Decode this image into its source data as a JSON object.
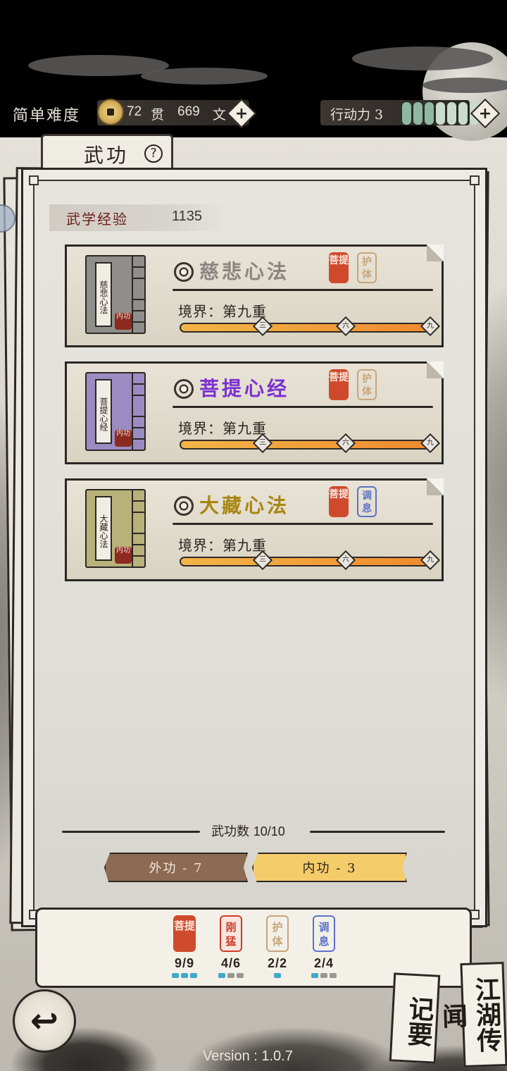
{
  "status": {
    "difficulty": "简单难度",
    "money_guan": "72",
    "money_guan_unit": "贯",
    "money_wen": "669",
    "money_wen_unit": "文",
    "action_label": "行动力 3",
    "action_pips_filled": 3,
    "action_pips_total": 7,
    "plus": "+"
  },
  "tab": {
    "title": "武功",
    "help": "?"
  },
  "exp": {
    "label": "武学经验",
    "value": "1135"
  },
  "skills": [
    {
      "name": "慈悲心法",
      "name_color": "#8a8781",
      "book_title": "慈悲心法",
      "book_color": "#8f8e8b",
      "book_seal": "内功",
      "tag1": "菩提",
      "tag2": "护体",
      "tag2_style": "tan",
      "realm": "境界：第九重",
      "marks": [
        "三",
        "六",
        "九"
      ],
      "progress": 1.0
    },
    {
      "name": "菩提心经",
      "name_color": "#7b2fd0",
      "book_title": "菩提心经",
      "book_color": "#9a8cc2",
      "book_seal": "内功",
      "tag1": "菩提",
      "tag2": "护体",
      "tag2_style": "tan",
      "realm": "境界：第九重",
      "marks": [
        "三",
        "六",
        "九"
      ],
      "progress": 1.0
    },
    {
      "name": "大藏心法",
      "name_color": "#a88612",
      "book_title": "大藏心法",
      "book_color": "#b8b27a",
      "book_seal": "内功",
      "tag1": "菩提",
      "tag2": "调息",
      "tag2_style": "blue",
      "realm": "境界：第九重",
      "marks": [
        "三",
        "六",
        "九"
      ],
      "progress": 1.0
    }
  ],
  "count": {
    "label": "武功数",
    "value": "10/10"
  },
  "type_buttons": {
    "outer": "外功 - 7",
    "inner": "内功 - 3"
  },
  "summary": [
    {
      "tag": "菩提",
      "count": "9/9",
      "style": "red",
      "filled": 3,
      "total": 3
    },
    {
      "tag": "刚猛",
      "count": "4/6",
      "style": "red-outline",
      "filled": 1,
      "total": 3
    },
    {
      "tag": "护体",
      "count": "2/2",
      "style": "tan",
      "filled": 1,
      "total": 1
    },
    {
      "tag": "调息",
      "count": "2/4",
      "style": "blue",
      "filled": 1,
      "total": 3
    }
  ],
  "bottom": {
    "back_glyph": "↩",
    "notes_tab": "记要",
    "rumors_tab": "江湖传闻",
    "version": "Version : 1.0.7"
  }
}
